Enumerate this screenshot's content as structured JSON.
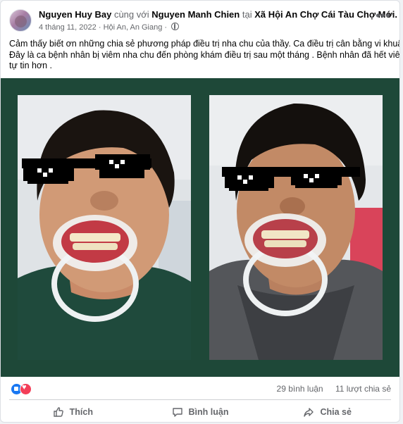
{
  "post": {
    "author": "Nguyen Huy Bay",
    "with_text": "cùng với",
    "tagged": "Nguyen Manh Chien",
    "at_text": "tại",
    "location": "Xã Hội An Chợ Cái Tàu Chợ Mới.",
    "date": "4 tháng 11, 2022",
    "separator": "·",
    "place": "Hội An, An Giang",
    "privacy_icon": "globe-icon",
    "more_icon": "more-options-icon",
    "text_lines": [
      "Cảm thấy biết ơn những chia sẻ phương pháp điều trị nha chu của thầy. Ca điều trị cân bằng vi khuẩn .",
      "Đây là ca bệnh nhân bị viêm nha chu đến phòng khám điều  trị sau một tháng . Bệnh nhân đã hết viêm",
      "tự tin hơn ."
    ]
  },
  "media": {
    "background": "#1e4838",
    "photos": [
      "before-treatment-photo",
      "after-treatment-photo"
    ]
  },
  "engagement": {
    "reactions": [
      "like",
      "love"
    ],
    "comments": "29 bình luận",
    "shares": "11 lượt chia sẻ"
  },
  "actions": {
    "like": "Thích",
    "comment": "Bình luận",
    "share": "Chia sẻ"
  },
  "colors": {
    "accent": "#1877f2",
    "love": "#f33e58",
    "secondary_text": "#65676b"
  }
}
